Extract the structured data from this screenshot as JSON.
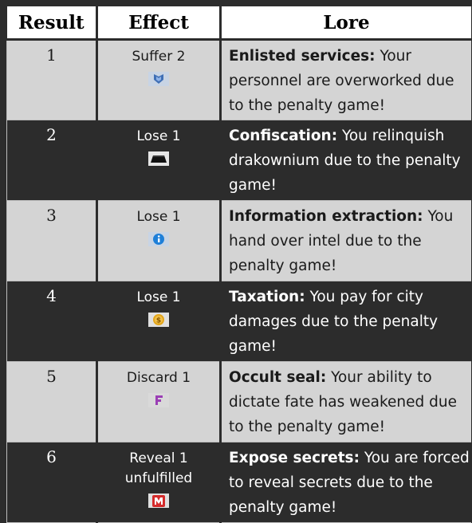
{
  "header": {
    "result": "Result",
    "effect": "Effect",
    "lore": "Lore"
  },
  "rows": [
    {
      "result": "1",
      "effect": "Suffer 2",
      "icon": "morale-shield-icon",
      "lore_title": "Enlisted services:",
      "lore_text": " Your personnel are overworked due to the penalty game!"
    },
    {
      "result": "2",
      "effect": "Lose 1",
      "icon": "drakownium-ingot-icon",
      "lore_title": "Confiscation:",
      "lore_text": " You relinquish drakownium due to the penalty game!"
    },
    {
      "result": "3",
      "effect": "Lose 1",
      "icon": "info-icon",
      "lore_title": "Information extraction:",
      "lore_text": " You hand over intel due to the penalty game!"
    },
    {
      "result": "4",
      "effect": "Lose 1",
      "icon": "coin-icon",
      "lore_title": "Taxation:",
      "lore_text": " You pay for city damages due to the penalty game!"
    },
    {
      "result": "5",
      "effect": "Discard 1",
      "icon": "fate-card-icon",
      "lore_title": "Occult seal:",
      "lore_text": " Your ability to dictate fate has weakened due to the penalty game!"
    },
    {
      "result": "6",
      "effect": "Reveal 1 unfulfilled",
      "icon": "secret-objective-icon",
      "lore_title": "Expose secrets:",
      "lore_text": " You are forced to reveal secrets due to the penalty game!"
    }
  ]
}
